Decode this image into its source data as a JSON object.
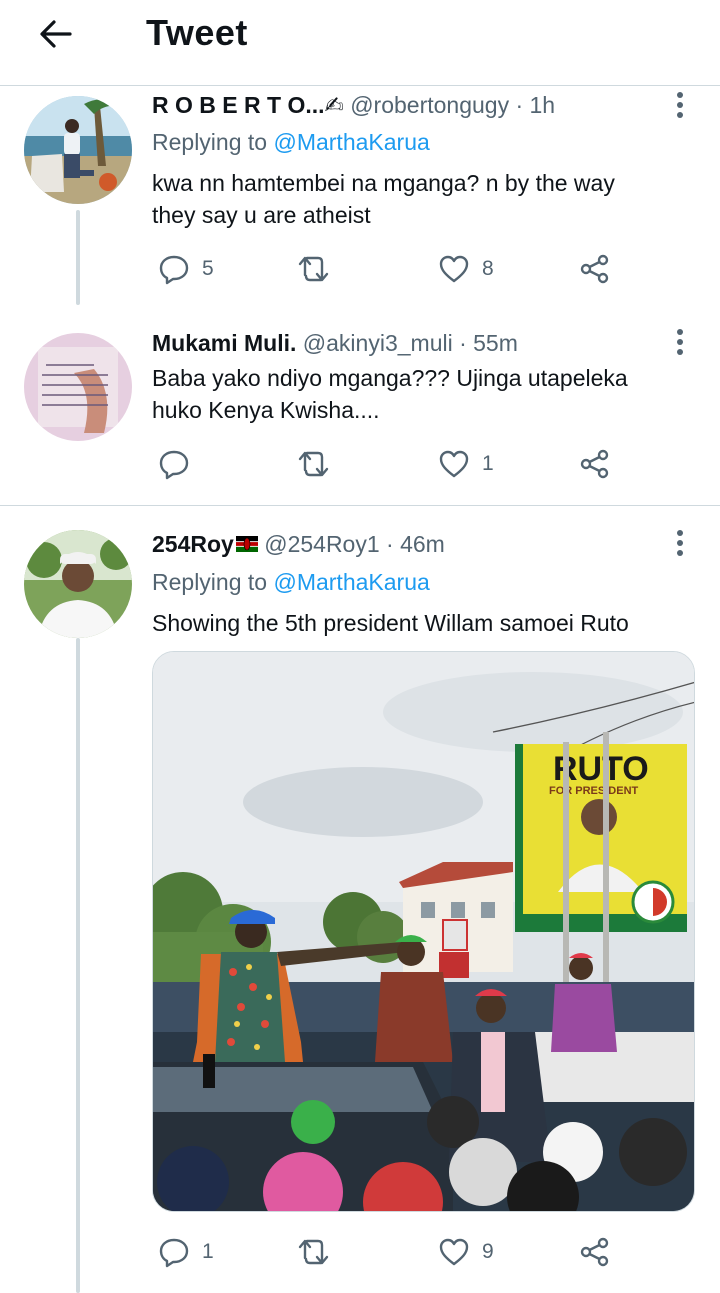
{
  "header": {
    "title": "Tweet",
    "back_icon": "back-arrow-icon"
  },
  "tweets": [
    {
      "name": "R O B E R T O...✍",
      "handle": "@robertongugy",
      "time": "· 1h",
      "replying_prefix": "Replying to ",
      "replying_to": "@MarthaKarua",
      "text_lines": [
        "kwa nn hamtembei na mganga? n by the way",
        "they say u are atheist"
      ],
      "replies": "5",
      "retweets": "",
      "likes": "8"
    },
    {
      "name": "Mukami Muli.",
      "handle": "@akinyi3_muli",
      "time": "· 55m",
      "text_lines": [
        "Baba yako ndiyo mganga??? Ujinga utapeleka",
        "huko Kenya Kwisha...."
      ],
      "replies": "",
      "retweets": "",
      "likes": "1"
    },
    {
      "name": "254Roy",
      "flag_icon": "kenya-flag-icon",
      "handle": "@254Roy1",
      "time": "· 46m",
      "replying_prefix": "Replying to ",
      "replying_to": "@MarthaKarua",
      "text_lines": [
        "Showing the 5th president Willam samoei Ruto"
      ],
      "replies": "1",
      "retweets": "",
      "likes": "9",
      "media": {
        "billboard_title": "RUTO",
        "billboard_subtitle": "FOR PRESIDENT"
      }
    }
  ],
  "colors": {
    "accent": "#1d9bf0",
    "secondary_text": "#536471",
    "divider": "#cfd9de"
  }
}
